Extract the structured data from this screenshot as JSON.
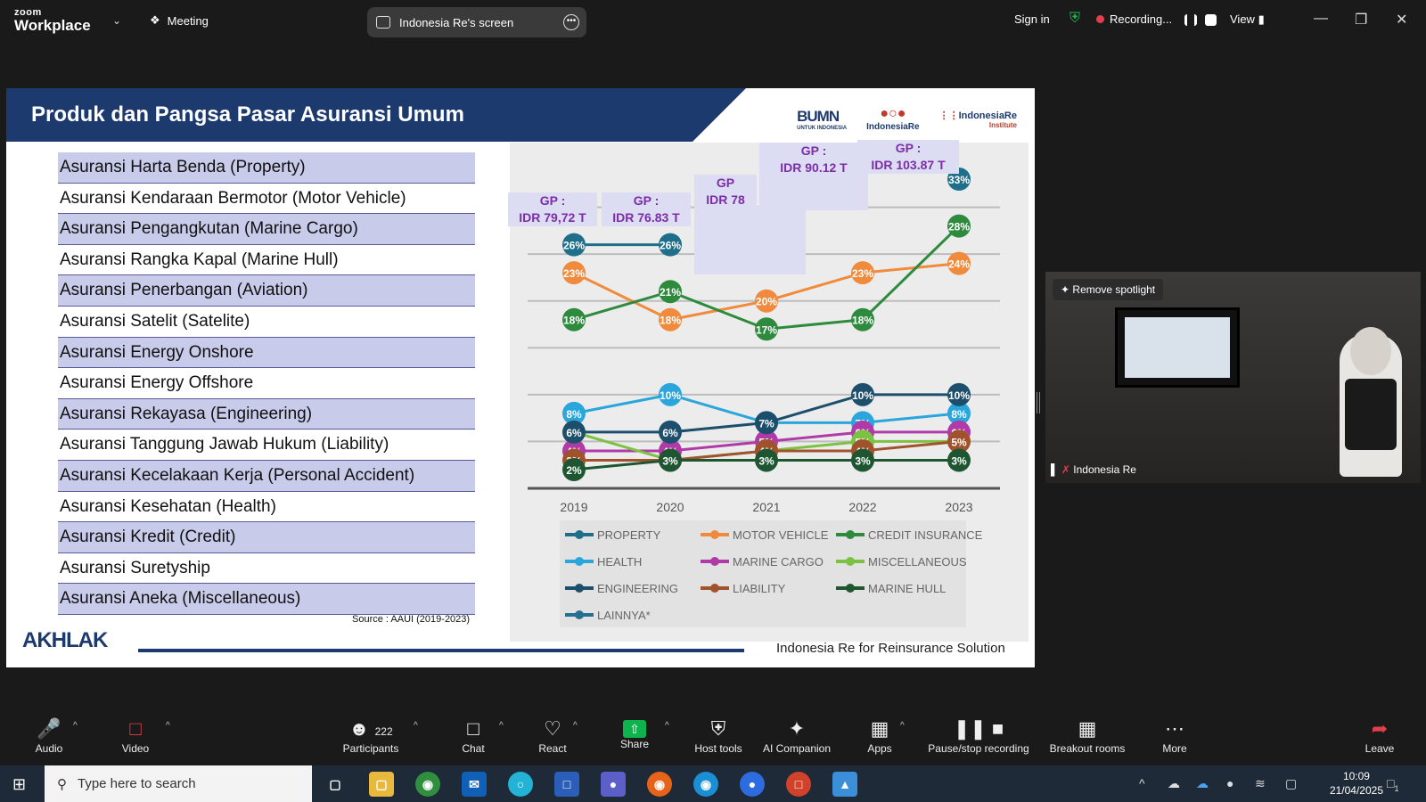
{
  "app": {
    "logo_top": "zoom",
    "logo_bottom": "Workplace",
    "meeting_label": "Meeting",
    "screen_share_label": "Indonesia Re's screen",
    "sign_in": "Sign in",
    "recording_label": "Recording...",
    "view_label": "View"
  },
  "slide": {
    "title": "Produk dan Pangsa Pasar Asuransi Umum",
    "logo_bumn": "BUMN",
    "logo_bumn_sub": "UNTUK INDONESIA",
    "logo_ire": "IndonesiaRe",
    "logo_ire_institute": "IndonesiaRe",
    "logo_ire_institute_sub": "Institute",
    "products": [
      "Asuransi Harta Benda (Property)",
      "Asuransi Kendaraan Bermotor (Motor Vehicle)",
      "Asuransi Pengangkutan (Marine Cargo)",
      "Asuransi Rangka Kapal (Marine Hull)",
      "Asuransi Penerbangan (Aviation)",
      "Asuransi Satelit (Satelite)",
      "Asuransi Energy Onshore",
      "Asuransi Energy Offshore",
      "Asuransi Rekayasa (Engineering)",
      "Asuransi Tanggung Jawab Hukum (Liability)",
      "Asuransi Kecelakaan Kerja (Personal Accident)",
      "Asuransi Kesehatan (Health)",
      "Asuransi Kredit (Credit)",
      "Asuransi Suretyship",
      "Asuransi Aneka (Miscellaneous)"
    ],
    "source": "Source : AAUI (2019-2023)",
    "footer_brand": "AKHLAK",
    "footer_tagline": "Indonesia Re for Reinsurance Solution",
    "gp_labels": [
      {
        "line1": "GP :",
        "line2": "IDR 79,72 T"
      },
      {
        "line1": "GP :",
        "line2": "IDR 76.83 T"
      },
      {
        "line1": "GP",
        "line2": "IDR 78"
      },
      {
        "line1": "GP :",
        "line2": "IDR 90.12 T"
      },
      {
        "line1": "GP :",
        "line2": "IDR 103.87 T"
      }
    ]
  },
  "chart_data": {
    "type": "line",
    "x": [
      "2019",
      "2020",
      "2021",
      "2022",
      "2023"
    ],
    "ylim": [
      0,
      35
    ],
    "grid": true,
    "legend_position": "bottom",
    "series": [
      {
        "name": "PROPERTY",
        "color": "#1f6f8b",
        "values": [
          26,
          26,
          null,
          null,
          33
        ],
        "labels": [
          "26%",
          "26%",
          "",
          "",
          "33%"
        ]
      },
      {
        "name": "MOTOR VEHICLE",
        "color": "#f08a3c",
        "values": [
          23,
          18,
          20,
          23,
          24
        ],
        "labels": [
          "23%",
          "18%",
          "20%",
          "23%",
          "24%"
        ]
      },
      {
        "name": "CREDIT INSURANCE",
        "color": "#2e8b3e",
        "values": [
          18,
          21,
          17,
          18,
          28
        ],
        "labels": [
          "18%",
          "21%",
          "17%",
          "18%",
          "28%"
        ]
      },
      {
        "name": "HEALTH",
        "color": "#2aa6dc",
        "values": [
          8,
          10,
          7,
          7,
          8
        ],
        "labels": [
          "8%",
          "10%",
          "7%",
          "7%",
          "8%"
        ]
      },
      {
        "name": "MARINE CARGO",
        "color": "#b03aa8",
        "values": [
          4,
          4,
          5,
          6,
          6
        ],
        "labels": [
          "4%",
          "4%",
          "5%",
          "6%",
          "6%"
        ]
      },
      {
        "name": "MISCELLANEOUS",
        "color": "#7cc242",
        "values": [
          6,
          3,
          4,
          5,
          5
        ],
        "labels": [
          "",
          "",
          "",
          "5%",
          ""
        ]
      },
      {
        "name": "ENGINEERING",
        "color": "#1d4e6b",
        "values": [
          6,
          6,
          7,
          10,
          10
        ],
        "labels": [
          "6%",
          "6%",
          "7%",
          "10%",
          "10%"
        ]
      },
      {
        "name": "LIABILITY",
        "color": "#a0522d",
        "values": [
          3,
          3,
          4,
          4,
          5
        ],
        "labels": [
          "3%",
          "3%",
          "4%",
          "4%",
          "5%"
        ]
      },
      {
        "name": "MARINE HULL",
        "color": "#1e5631",
        "values": [
          2,
          3,
          3,
          3,
          3
        ],
        "labels": [
          "2%",
          "3%",
          "3%",
          "3%",
          "3%"
        ]
      },
      {
        "name": "LAINNYA*",
        "color": "#256f8f",
        "values": [
          null,
          null,
          null,
          null,
          null
        ],
        "labels": [
          "",
          "",
          "",
          "",
          ""
        ]
      }
    ]
  },
  "video": {
    "remove_spotlight": "Remove spotlight",
    "participant_name": "Indonesia Re"
  },
  "toolbar": {
    "audio": "Audio",
    "video": "Video",
    "participants": "Participants",
    "participants_count": "222",
    "chat": "Chat",
    "react": "React",
    "share": "Share",
    "host_tools": "Host tools",
    "ai_companion": "AI Companion",
    "apps": "Apps",
    "pause_stop": "Pause/stop recording",
    "breakout": "Breakout rooms",
    "more": "More",
    "leave": "Leave"
  },
  "taskbar": {
    "search_placeholder": "Type here to search",
    "time": "10:09",
    "date": "21/04/2025",
    "notification_count": "1"
  }
}
